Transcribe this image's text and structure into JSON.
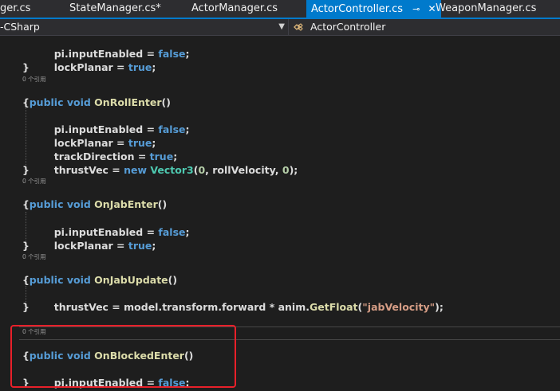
{
  "tabs": [
    {
      "label": "ger.cs"
    },
    {
      "label": "StateManager.cs*"
    },
    {
      "label": "ActorManager.cs"
    },
    {
      "label": "ActorController.cs",
      "pin": "⊸",
      "close": "✕"
    },
    {
      "label": "WeaponManager.cs"
    }
  ],
  "nav": {
    "project": "-CSharp",
    "class": "ActorController"
  },
  "code": {
    "refs_label": "0 个引用",
    "lines": [
      "pi.inputEnabled = false;",
      "lockPlanar = true;",
      "}",
      "public void OnRollEnter()",
      "{",
      "pi.inputEnabled = false;",
      "lockPlanar = true;",
      "trackDirection = true;",
      "thrustVec = new Vector3(0, rollVelocity, 0);",
      "}",
      "public void OnJabEnter()",
      "{",
      "pi.inputEnabled = false;",
      "lockPlanar = true;",
      "}",
      "public void OnJabUpdate()",
      "{",
      "thrustVec = model.transform.forward * anim.GetFloat(\"jabVelocity\");",
      "}",
      "public void OnBlockedEnter()",
      "{",
      "pi.inputEnabled = false;",
      "}"
    ]
  },
  "colors": {
    "accent": "#007acc",
    "keyword": "#569cd6",
    "method": "#dcdcaa",
    "type": "#4ec9b0",
    "string": "#d69d85",
    "number": "#b5cea8",
    "highlight_box": "#e8202a"
  }
}
